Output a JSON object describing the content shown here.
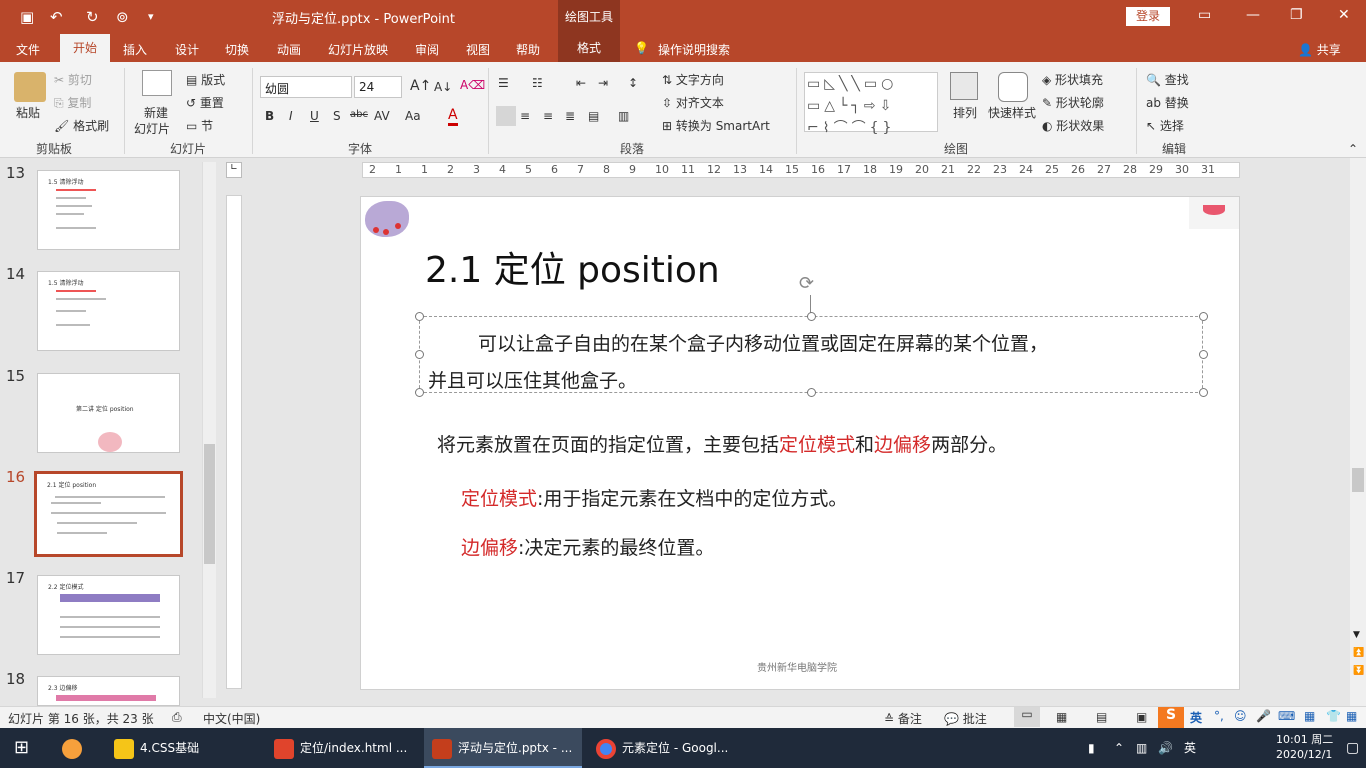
{
  "titlebar": {
    "doc_title": "浮动与定位.pptx  -  PowerPoint",
    "draw_tools": "绘图工具",
    "login": "登录"
  },
  "tabs": [
    "文件",
    "开始",
    "插入",
    "设计",
    "切换",
    "动画",
    "幻灯片放映",
    "审阅",
    "视图",
    "帮助",
    "格式",
    "操作说明搜索",
    "共享"
  ],
  "ribbon": {
    "clipboard": {
      "paste": "粘贴",
      "cut": "剪切",
      "copy": "复制",
      "format_painter": "格式刷",
      "label": "剪贴板"
    },
    "slides": {
      "new_slide": "新建",
      "new_slide2": "幻灯片",
      "layout": "版式",
      "reset": "重置",
      "section": "节",
      "label": "幻灯片"
    },
    "font": {
      "name": "幼圆",
      "size": "24",
      "label": "字体"
    },
    "paragraph": {
      "text_direction": "文字方向",
      "align_text": "对齐文本",
      "smartart": "转换为 SmartArt",
      "label": "段落"
    },
    "drawing": {
      "arrange": "排列",
      "quick_styles": "快速样式",
      "fill": "形状填充",
      "outline": "形状轮廓",
      "effects": "形状效果",
      "label": "绘图"
    },
    "editing": {
      "find": "查找",
      "replace": "替换",
      "select": "选择",
      "label": "编辑"
    }
  },
  "ruler_numbers": [
    "2",
    "1",
    "1",
    "2",
    "3",
    "4",
    "5",
    "6",
    "7",
    "8",
    "9",
    "10",
    "11",
    "12",
    "13",
    "14",
    "15",
    "16",
    "17",
    "18",
    "19",
    "20",
    "21",
    "22",
    "23",
    "24",
    "25",
    "26",
    "27",
    "28",
    "29",
    "30",
    "31"
  ],
  "thumbnails": [
    {
      "num": "13",
      "title": "1.5 清除浮动"
    },
    {
      "num": "14",
      "title": "1.5 清除浮动"
    },
    {
      "num": "15",
      "title": "第二讲  定位 position"
    },
    {
      "num": "16",
      "title": "2.1 定位 position"
    },
    {
      "num": "17",
      "title": "2.2 定位模式"
    },
    {
      "num": "18",
      "title": "2.3 边偏移"
    }
  ],
  "slide": {
    "title": "2.1 定位 position",
    "para1_line1": "可以让盒子自由的在某个盒子内移动位置或固定在屏幕的某个位置，",
    "para1_line2": "并且可以压住其他盒子。",
    "para2_a": "将元素放置在页面的指定位置，主要包括",
    "para2_red1": "定位模式",
    "para2_b": "和",
    "para2_red2": "边偏移",
    "para2_c": "两部分。",
    "item1_red": "定位模式",
    "item1_text": ":用于指定元素在文档中的定位方式。",
    "item2_red": "边偏移",
    "item2_text": ":决定元素的最终位置。",
    "footer": "贵州新华电脑学院"
  },
  "statusbar": {
    "slide_info": "幻灯片 第 16 张，共 23 张",
    "language": "中文(中国)",
    "notes": "备注",
    "comments": "批注"
  },
  "taskbar": {
    "items": [
      "4.CSS基础",
      "定位/index.html ...",
      "浮动与定位.pptx - ...",
      "元素定位 - Googl..."
    ],
    "time": "10:01 周二",
    "date": "2020/12/1",
    "ime": "英"
  },
  "colors": {
    "accent": "#b7472a",
    "red_text": "#d42a2a"
  }
}
